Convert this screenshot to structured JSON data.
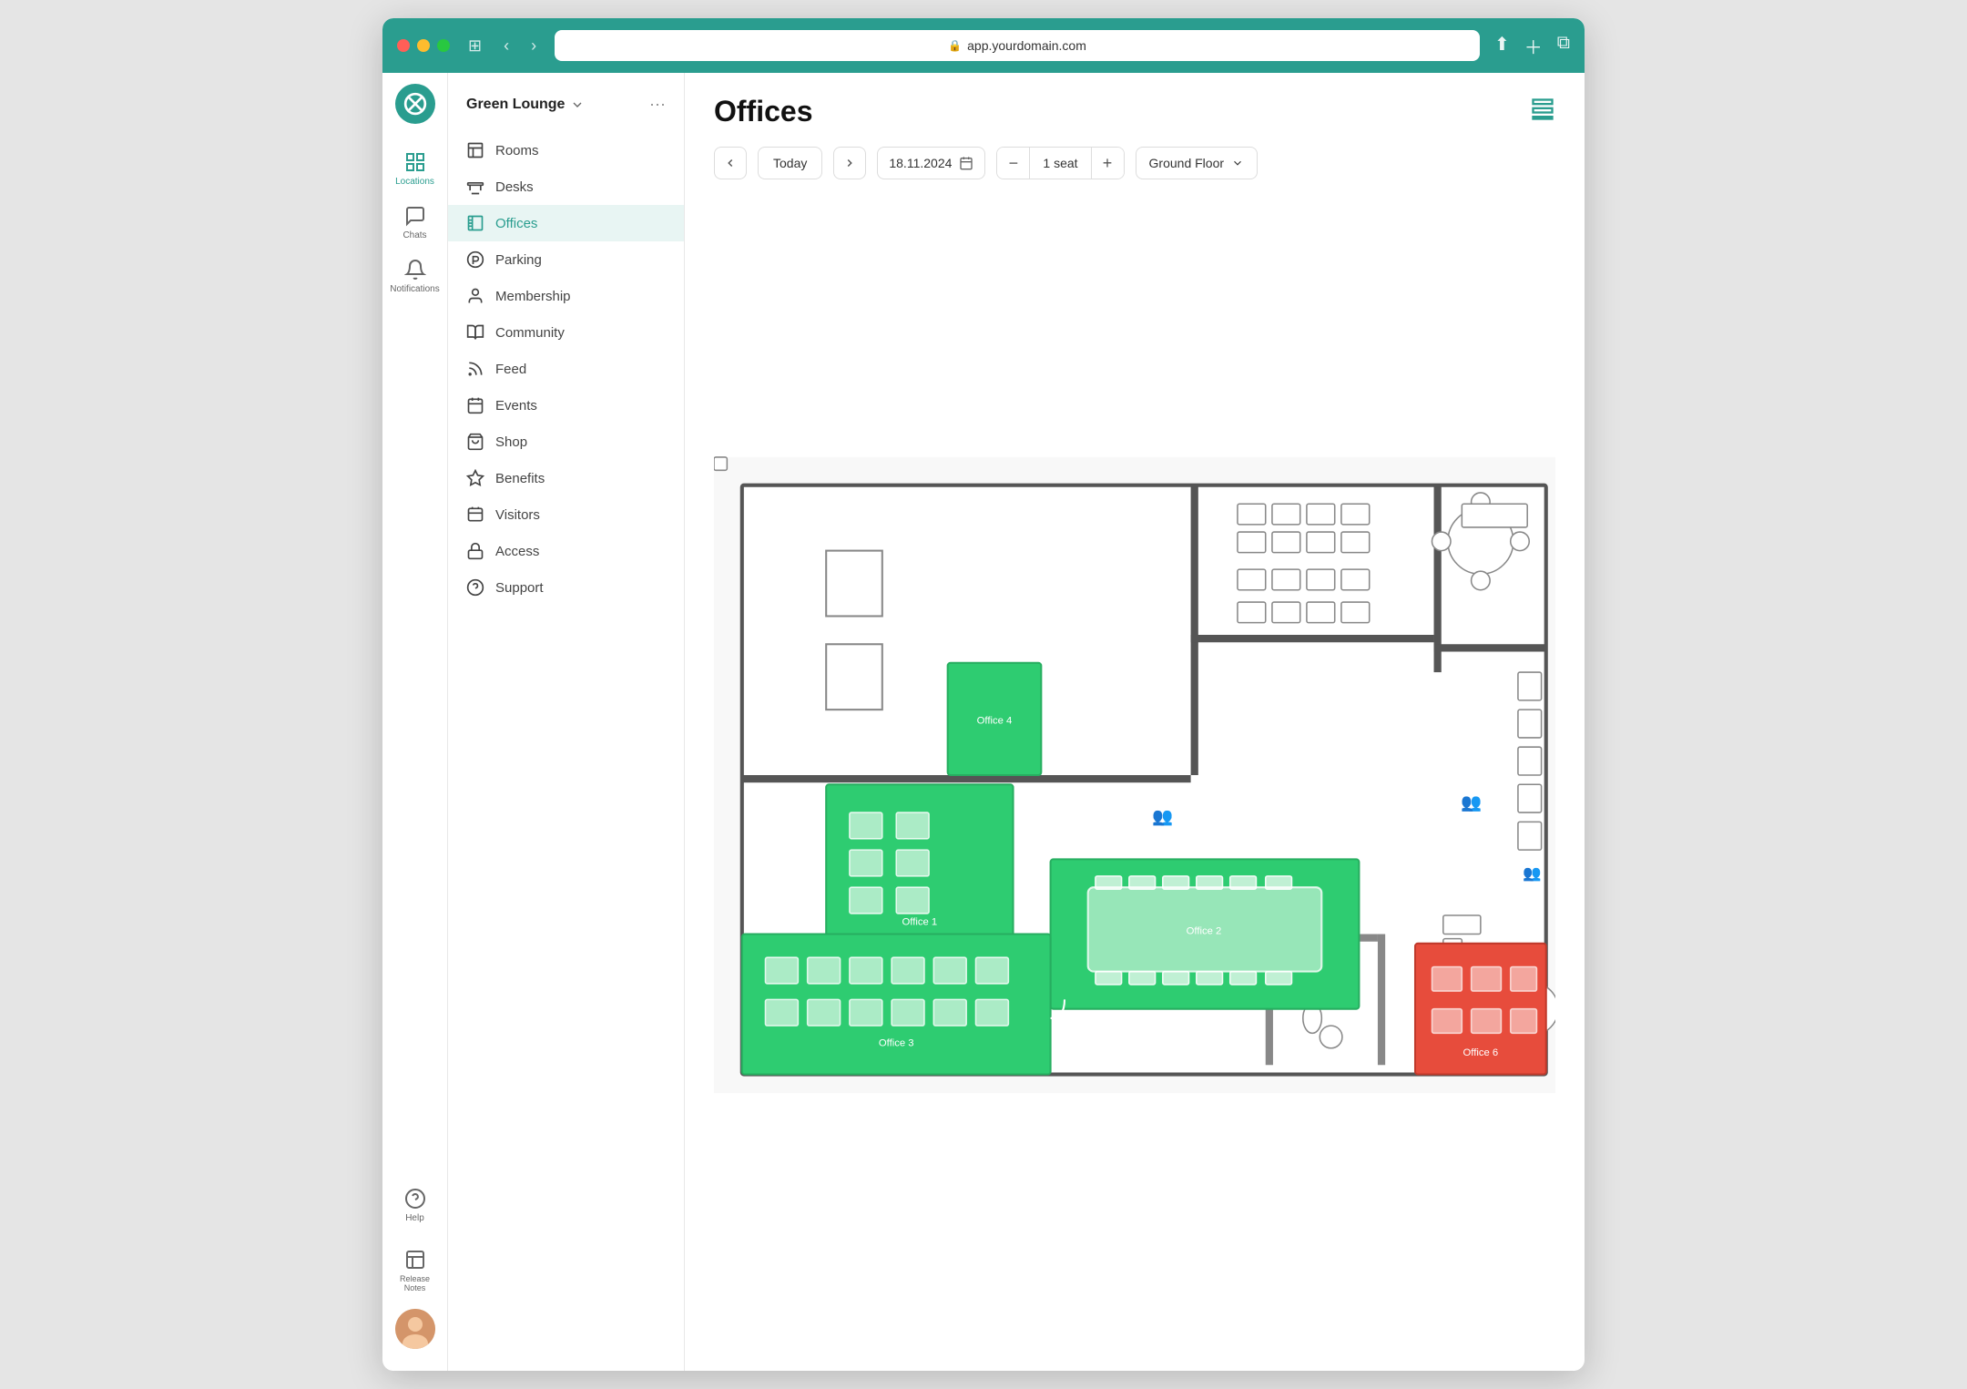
{
  "browser": {
    "url": "app.yourdomain.com",
    "lock_icon": "🔒"
  },
  "app": {
    "logo": "✕",
    "workspace": {
      "name": "Green Lounge",
      "dropdown_icon": "chevron-down"
    }
  },
  "nav_icons": [
    {
      "id": "locations",
      "label": "Locations",
      "active": true
    },
    {
      "id": "chats",
      "label": "Chats",
      "active": false
    },
    {
      "id": "notifications",
      "label": "Notifications",
      "active": false
    }
  ],
  "bottom_nav": [
    {
      "id": "help",
      "label": "Help"
    },
    {
      "id": "release-notes",
      "label": "Release Notes"
    }
  ],
  "sidebar": {
    "items": [
      {
        "id": "rooms",
        "label": "Rooms",
        "active": false
      },
      {
        "id": "desks",
        "label": "Desks",
        "active": false
      },
      {
        "id": "offices",
        "label": "Offices",
        "active": true
      },
      {
        "id": "parking",
        "label": "Parking",
        "active": false
      },
      {
        "id": "membership",
        "label": "Membership",
        "active": false
      },
      {
        "id": "community",
        "label": "Community",
        "active": false
      },
      {
        "id": "feed",
        "label": "Feed",
        "active": false
      },
      {
        "id": "events",
        "label": "Events",
        "active": false
      },
      {
        "id": "shop",
        "label": "Shop",
        "active": false
      },
      {
        "id": "benefits",
        "label": "Benefits",
        "active": false
      },
      {
        "id": "visitors",
        "label": "Visitors",
        "active": false
      },
      {
        "id": "access",
        "label": "Access",
        "active": false
      },
      {
        "id": "support",
        "label": "Support",
        "active": false
      }
    ]
  },
  "main": {
    "title": "Offices",
    "toolbar": {
      "today_label": "Today",
      "date_value": "18.11.2024",
      "seat_count": "1 seat",
      "floor_label": "Ground Floor",
      "prev_label": "‹",
      "next_label": "›"
    },
    "offices": [
      {
        "id": "office1",
        "label": "Office 1",
        "status": "available"
      },
      {
        "id": "office2",
        "label": "Office 2",
        "status": "available"
      },
      {
        "id": "office3",
        "label": "Office 3",
        "status": "available"
      },
      {
        "id": "office4",
        "label": "Office 4",
        "status": "available"
      },
      {
        "id": "office6",
        "label": "Office 6",
        "status": "booked"
      }
    ]
  }
}
